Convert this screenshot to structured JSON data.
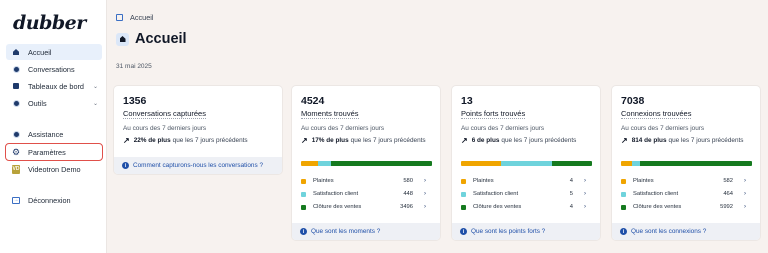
{
  "app": {
    "logo": "dubber"
  },
  "sidebar": {
    "items": [
      {
        "label": "Accueil"
      },
      {
        "label": "Conversations"
      },
      {
        "label": "Tableaux de bord"
      },
      {
        "label": "Outils"
      },
      {
        "label": "Assistance"
      },
      {
        "label": "Paramètres"
      },
      {
        "label": "Videotron Demo",
        "badge": "VD"
      },
      {
        "label": "Déconnexion"
      }
    ]
  },
  "breadcrumb": {
    "label": "Accueil"
  },
  "page": {
    "title": "Accueil",
    "date": "31 mai 2025"
  },
  "cards": [
    {
      "value": "1356",
      "label": "Conversations capturées",
      "period": "Au cours des 7 derniers jours",
      "trend_value": "22% de plus",
      "trend_rest": "que les 7 jours précédents",
      "footer": "Comment capturons-nous les conversations ?"
    },
    {
      "value": "4524",
      "label": "Moments trouvés",
      "period": "Au cours des 7 derniers jours",
      "trend_value": "17% de plus",
      "trend_rest": "que les 7 jours précédents",
      "breakdown": [
        {
          "name": "Plaintes",
          "value": "580"
        },
        {
          "name": "Satisfaction client",
          "value": "448"
        },
        {
          "name": "Clôture des ventes",
          "value": "3496"
        }
      ],
      "footer": "Que sont les moments ?"
    },
    {
      "value": "13",
      "label": "Points forts trouvés",
      "period": "Au cours des 7 derniers jours",
      "trend_value": "6 de plus",
      "trend_rest": "que les 7 jours précédents",
      "breakdown": [
        {
          "name": "Plaintes",
          "value": "4"
        },
        {
          "name": "Satisfaction client",
          "value": "5"
        },
        {
          "name": "Clôture des ventes",
          "value": "4"
        }
      ],
      "footer": "Que sont les points forts ?"
    },
    {
      "value": "7038",
      "label": "Connexions trouvées",
      "period": "Au cours des 7 derniers jours",
      "trend_value": "814 de plus",
      "trend_rest": "que les 7 jours précédents",
      "breakdown": [
        {
          "name": "Plaintes",
          "value": "582"
        },
        {
          "name": "Satisfaction client",
          "value": "464"
        },
        {
          "name": "Clôture des ventes",
          "value": "5992"
        }
      ],
      "footer": "Que sont les connexions ?"
    }
  ],
  "colors": {
    "plaintes": "#f0a500",
    "satisfaction": "#6fd3dc",
    "cloture": "#157a1f",
    "accent": "#1f4fa8",
    "highlight": "#e0504a"
  }
}
